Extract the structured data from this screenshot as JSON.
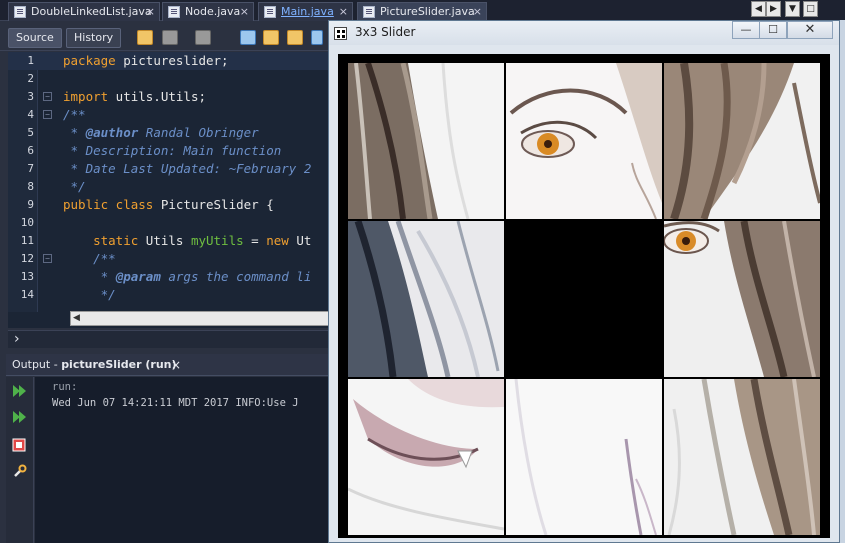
{
  "ide": {
    "tabs": [
      {
        "label": "DoubleLinkedList.java",
        "close": "×"
      },
      {
        "label": "Node.java",
        "close": "×"
      },
      {
        "label": "Main.java",
        "close": "×"
      },
      {
        "label": "PictureSlider.java",
        "close": "×"
      }
    ],
    "toolbar": {
      "source": "Source",
      "history": "History"
    },
    "code_lines": [
      {
        "n": "1",
        "text": "package pictureslider;"
      },
      {
        "n": "2",
        "text": ""
      },
      {
        "n": "3",
        "text": "import utils.Utils;"
      },
      {
        "n": "4",
        "text": "/**"
      },
      {
        "n": "5",
        "text": " * @author Randal Obringer"
      },
      {
        "n": "6",
        "text": " * Description: Main function"
      },
      {
        "n": "7",
        "text": " * Date Last Updated: ~February 2"
      },
      {
        "n": "8",
        "text": " */"
      },
      {
        "n": "9",
        "text": "public class PictureSlider {"
      },
      {
        "n": "10",
        "text": ""
      },
      {
        "n": "11",
        "text": "    static Utils myUtils = new Ut"
      },
      {
        "n": "12",
        "text": "    /**"
      },
      {
        "n": "13",
        "text": "     * @param args the command li"
      },
      {
        "n": "14",
        "text": "     */"
      }
    ],
    "output": {
      "title_prefix": "Output - ",
      "title_bold": "pictureSlider (run)",
      "close": "×",
      "lines": [
        "run:",
        "Wed Jun 07 14:21:11 MDT 2017 INFO:Use J"
      ]
    }
  },
  "window": {
    "title": "3x3 Slider",
    "minimize": "—",
    "maximize": "☐",
    "close": "✕",
    "tiles": [
      {
        "index": 0,
        "content": "hair-left-top"
      },
      {
        "index": 1,
        "content": "eye-left"
      },
      {
        "index": 2,
        "content": "hair-right-top"
      },
      {
        "index": 3,
        "content": "hair-left-middle"
      },
      {
        "index": 4,
        "content": "blank"
      },
      {
        "index": 5,
        "content": "eye-right"
      },
      {
        "index": 6,
        "content": "lips"
      },
      {
        "index": 7,
        "content": "chin"
      },
      {
        "index": 8,
        "content": "hair-right-bottom"
      }
    ]
  }
}
